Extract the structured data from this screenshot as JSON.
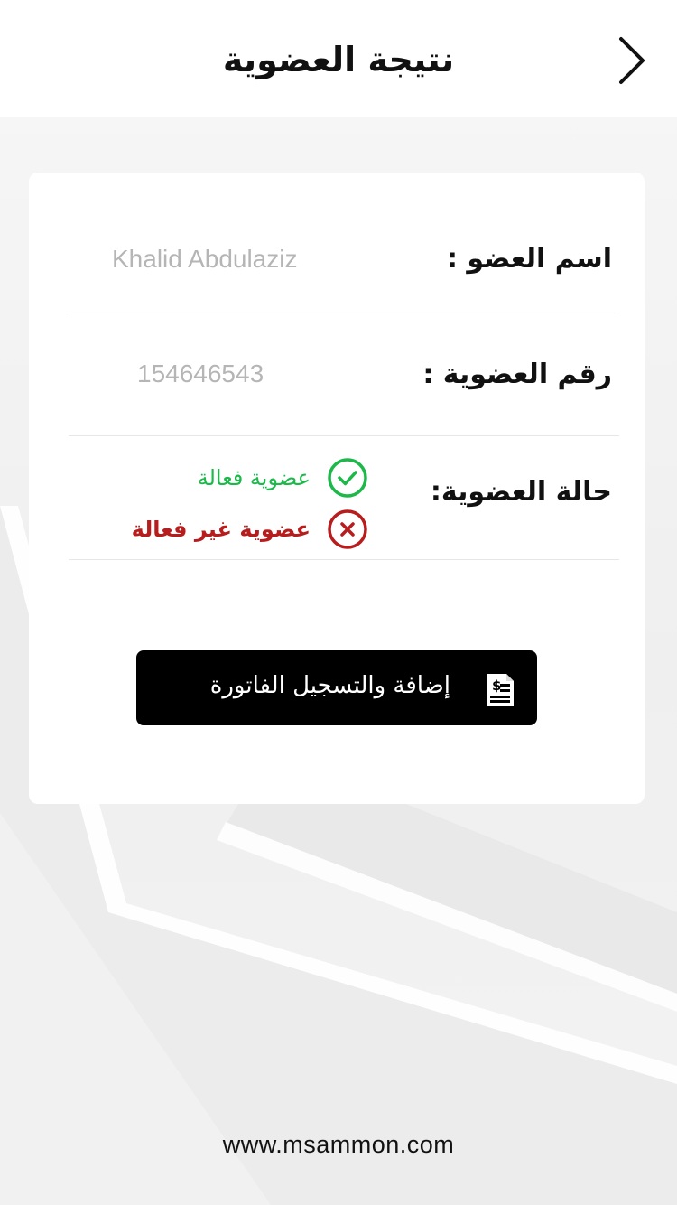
{
  "header": {
    "title": "نتيجة العضوية",
    "back_icon": "chevron-right-icon"
  },
  "member": {
    "name_label": "اسم العضو :",
    "name_value": "Khalid Abdulaziz",
    "number_label": "رقم العضوية :",
    "number_value": "154646543",
    "status_label": "حالة العضوية:",
    "status_active": "عضوية فعالة",
    "status_inactive": "عضوية غير فعالة"
  },
  "actions": {
    "add_invoice_label": "إضافة والتسجيل الفاتورة",
    "add_invoice_icon": "invoice-dollar-icon"
  },
  "footer": {
    "website": "www.msammon.com"
  },
  "colors": {
    "active": "#1cb84a",
    "inactive": "#b81c1c",
    "button_bg": "#000000"
  }
}
